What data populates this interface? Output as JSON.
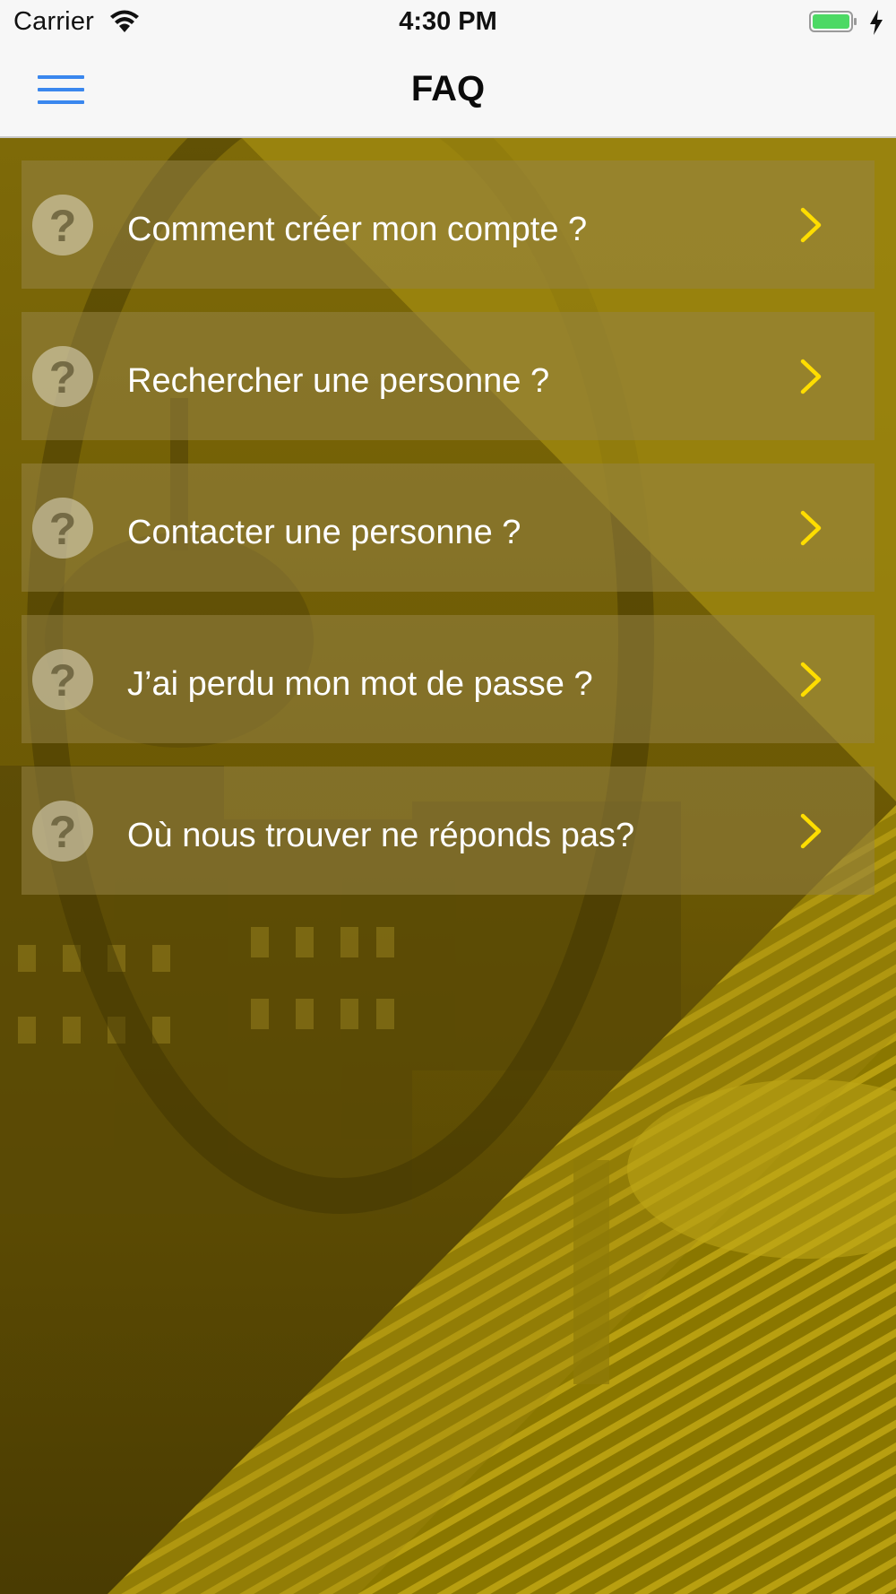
{
  "status_bar": {
    "carrier": "Carrier",
    "time": "4:30 PM",
    "icons": [
      "wifi-icon",
      "battery-icon",
      "charging-bolt-icon"
    ]
  },
  "nav_bar": {
    "title": "FAQ",
    "menu_icon": "hamburger-menu-icon"
  },
  "faq": {
    "items": [
      {
        "label": "Comment créer mon compte ?",
        "icon": "question-mark-icon"
      },
      {
        "label": "Rechercher une personne ?",
        "icon": "question-mark-icon"
      },
      {
        "label": "Contacter une personne ?",
        "icon": "question-mark-icon"
      },
      {
        "label": "J’ai perdu mon mot de passe ?",
        "icon": "question-mark-icon"
      },
      {
        "label": "Où nous trouver ne réponds pas?",
        "icon": "question-mark-icon"
      }
    ],
    "question_glyph": "?"
  },
  "colors": {
    "accent": "#3a87ee",
    "chevron": "#ffdd00",
    "overlay": "#8a7a00",
    "battery": "#4cd964"
  }
}
